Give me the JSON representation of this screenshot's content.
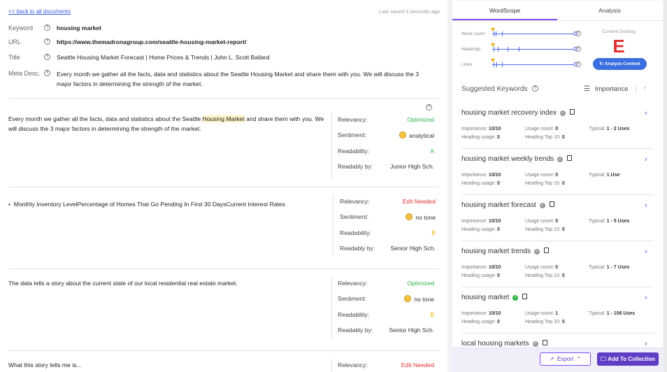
{
  "header": {
    "back_link": "<< back to all documents",
    "saved": "Last saved 3 seconds ago"
  },
  "meta": {
    "keyword_label": "Keyword",
    "keyword": "housing market",
    "url_label": "URL",
    "url": "https://www.themadronagroup.com/seattle-housing-market-report/",
    "title_label": "Title",
    "title": "Seattle Housing Market Forecast | Home Prices & Trends | John L. Scott Ballard",
    "desc_label": "Meta Desc.",
    "desc": "Every month we gather all the facts, data and statistics about the Seattle Housing Market and share them with you.  We will discuss the 3 major factors in determining the strength of the market."
  },
  "paragraphs": [
    {
      "text_before": "Every month we gather all the facts, data and statistics about the Seattle ",
      "highlight": "Housing Market",
      "text_after": " and share them with you. We will discuss the 3 major factors in determining the strength of the market.",
      "relevancy": "Optimized",
      "sentiment": "analytical",
      "readability": "A",
      "readable_by": "Junior High Sch."
    },
    {
      "bullet": "Monthly Inventory LevelPercentage of Homes That Go Pending In First 30 DaysCurrent Interest Rates",
      "relevancy": "Edit Needed",
      "sentiment": "no tone",
      "readability": "B",
      "readable_by": "Senior High Sch."
    },
    {
      "text": "The data tells a story about the current state of our local residential real estate market.",
      "relevancy": "Optimized",
      "sentiment": "no tone",
      "readability": "B",
      "readable_by": "Senior High Sch."
    },
    {
      "text": "What this story tells me is...",
      "relevancy": "Edit Needed"
    }
  ],
  "labels": {
    "relevancy": "Relevancy:",
    "sentiment": "Sentiment:",
    "readability": "Readability:",
    "readable_by": "Readably by:",
    "qmark": "?"
  },
  "panel": {
    "tabs": [
      "WordScope",
      "Analysis"
    ],
    "sliders": [
      {
        "label": "Word count"
      },
      {
        "label": "Headings"
      },
      {
        "label": "Links"
      }
    ],
    "content_grading": "Content Grading",
    "grade": "E",
    "analyze": "Analyze Content",
    "suggested": "Suggested Keywords",
    "sort": "Importance",
    "labels": {
      "importance": "Importance:",
      "usage": "Usage count:",
      "typical": "Typical:",
      "heading_usage": "Heading usage:",
      "heading_top": "Heading Top 10:"
    },
    "keywords": [
      {
        "name": "housing market recovery index",
        "importance": "10/10",
        "usage": "0",
        "typical": "1 - 2 Uses",
        "heading_usage": "0",
        "heading_top": "0",
        "used": false
      },
      {
        "name": "housing market weekly trends",
        "importance": "10/10",
        "usage": "0",
        "typical": "1 Use",
        "heading_usage": "0",
        "heading_top": "0",
        "used": false
      },
      {
        "name": "housing market forecast",
        "importance": "10/10",
        "usage": "0",
        "typical": "1 - 5 Uses",
        "heading_usage": "0",
        "heading_top": "0",
        "used": false
      },
      {
        "name": "housing market trends",
        "importance": "10/10",
        "usage": "0",
        "typical": "1 - 7 Uses",
        "heading_usage": "0",
        "heading_top": "0",
        "used": false
      },
      {
        "name": "housing market",
        "importance": "10/10",
        "usage": "1",
        "typical": "1 - 106 Uses",
        "heading_usage": "0",
        "heading_top": "0",
        "used": true
      },
      {
        "name": "local housing markets",
        "used": false
      }
    ],
    "export": "Export",
    "add_collection": "Add To Collection"
  },
  "colors": {
    "accent": "#7c4dff",
    "link": "#3b5bdb",
    "optimized": "#2fb344",
    "edit": "#e03131",
    "grade_b": "#f0b400"
  }
}
